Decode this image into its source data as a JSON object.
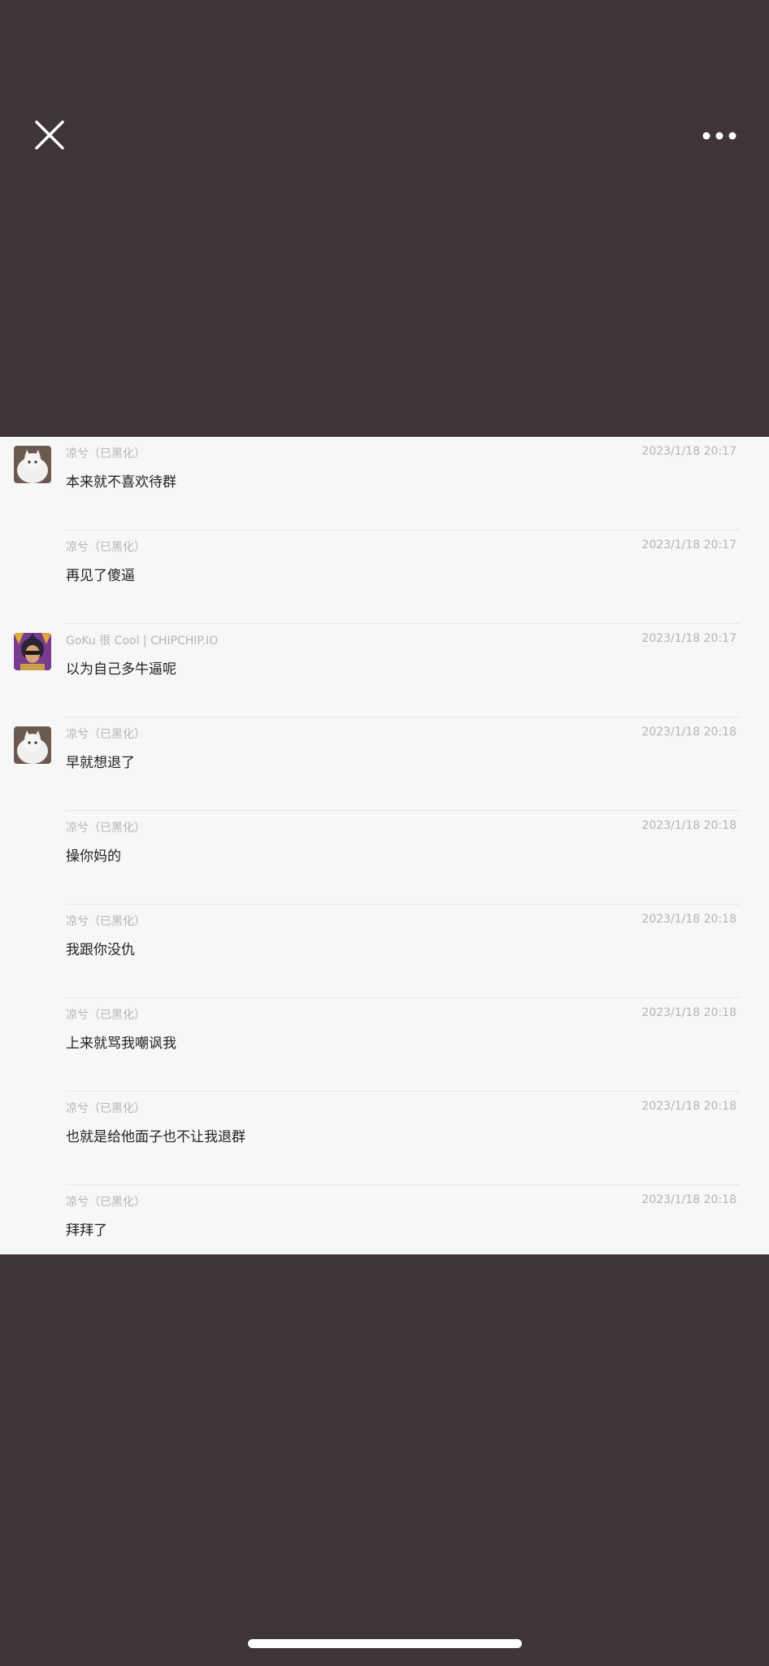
{
  "header": {
    "close_icon": "close-icon",
    "more_icon": "more-horizontal-icon"
  },
  "messages": [
    {
      "sender": "凉兮（已黑化）",
      "time": "2023/1/18 20:17",
      "text": "本来就不喜欢待群",
      "avatar": "cat-avatar"
    },
    {
      "sender": "凉兮（已黑化）",
      "time": "2023/1/18 20:17",
      "text": "再见了傻逼",
      "avatar": null
    },
    {
      "sender": "GoKu 很 Cool  |  CHIPCHIP.IO",
      "time": "2023/1/18 20:17",
      "text": "以为自己多牛逼呢",
      "avatar": "person-avatar"
    },
    {
      "sender": "凉兮（已黑化）",
      "time": "2023/1/18 20:18",
      "text": "早就想退了",
      "avatar": "cat-avatar"
    },
    {
      "sender": "凉兮（已黑化）",
      "time": "2023/1/18 20:18",
      "text": "操你妈的",
      "avatar": null
    },
    {
      "sender": "凉兮（已黑化）",
      "time": "2023/1/18 20:18",
      "text": "我跟你没仇",
      "avatar": null
    },
    {
      "sender": "凉兮（已黑化）",
      "time": "2023/1/18 20:18",
      "text": "上来就骂我嘲讽我",
      "avatar": null
    },
    {
      "sender": "凉兮（已黑化）",
      "time": "2023/1/18 20:18",
      "text": "也就是给他面子也不让我退群",
      "avatar": null
    },
    {
      "sender": "凉兮（已黑化）",
      "time": "2023/1/18 20:18",
      "text": "拜拜了",
      "avatar": null
    }
  ]
}
